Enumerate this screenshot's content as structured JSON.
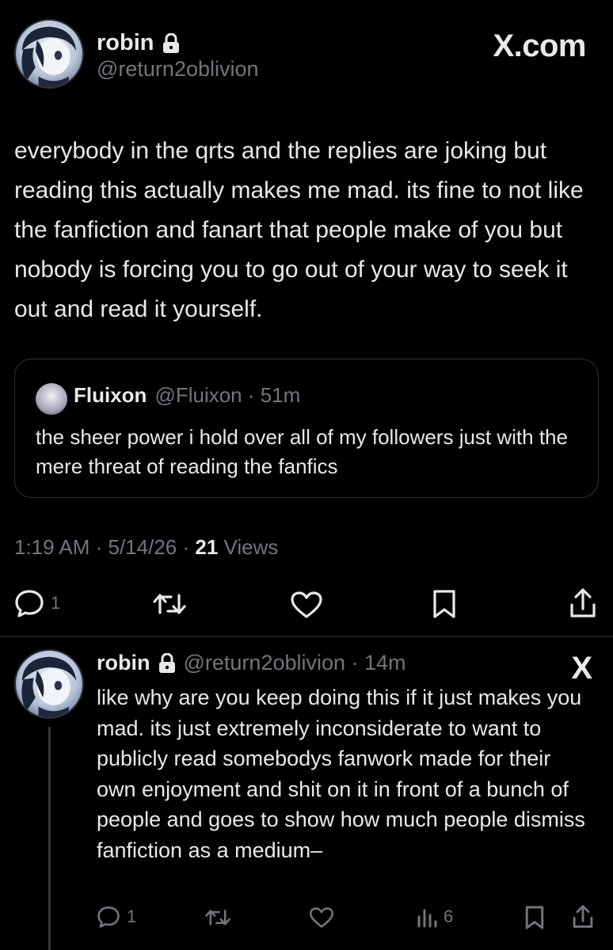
{
  "colors": {
    "background": "#000000",
    "text": "#e7e9ea",
    "muted": "#71767b",
    "border": "#2f3336"
  },
  "header": {
    "name": "robin",
    "handle": "@return2oblivion",
    "brand": "X.com"
  },
  "tweet": {
    "text": "everybody in the qrts and the replies are joking but reading this actually makes me mad. its fine to not like the fanfiction and fanart that people make of you but nobody is forcing you to go out of your way to seek it out and read it yourself.",
    "quote": {
      "name": "Fluixon",
      "meta": "@Fluixon · 51m",
      "text": "the sheer power i hold over all of my followers just with the mere threat of reading the fanfics"
    },
    "time": "1:19 AM · 5/14/26 · ",
    "views_count": "21",
    "views_label": " Views",
    "actions": {
      "reply_count": "1"
    }
  },
  "reply": {
    "name": "robin",
    "meta": "@return2oblivion · 14m",
    "brand": "X",
    "text": "like why are you keep doing this if it just makes you mad. its just extremely inconsiderate to want to publicly read somebodys fanwork made for their own enjoyment and shit on it in front of a bunch of people and goes to show how much people dismiss fanfiction as a medium–",
    "actions": {
      "reply_count": "1",
      "views_count": "6"
    }
  },
  "icons": [
    "lock-icon",
    "reply-icon",
    "retweet-icon",
    "like-icon",
    "bookmark-icon",
    "share-icon",
    "views-icon"
  ]
}
